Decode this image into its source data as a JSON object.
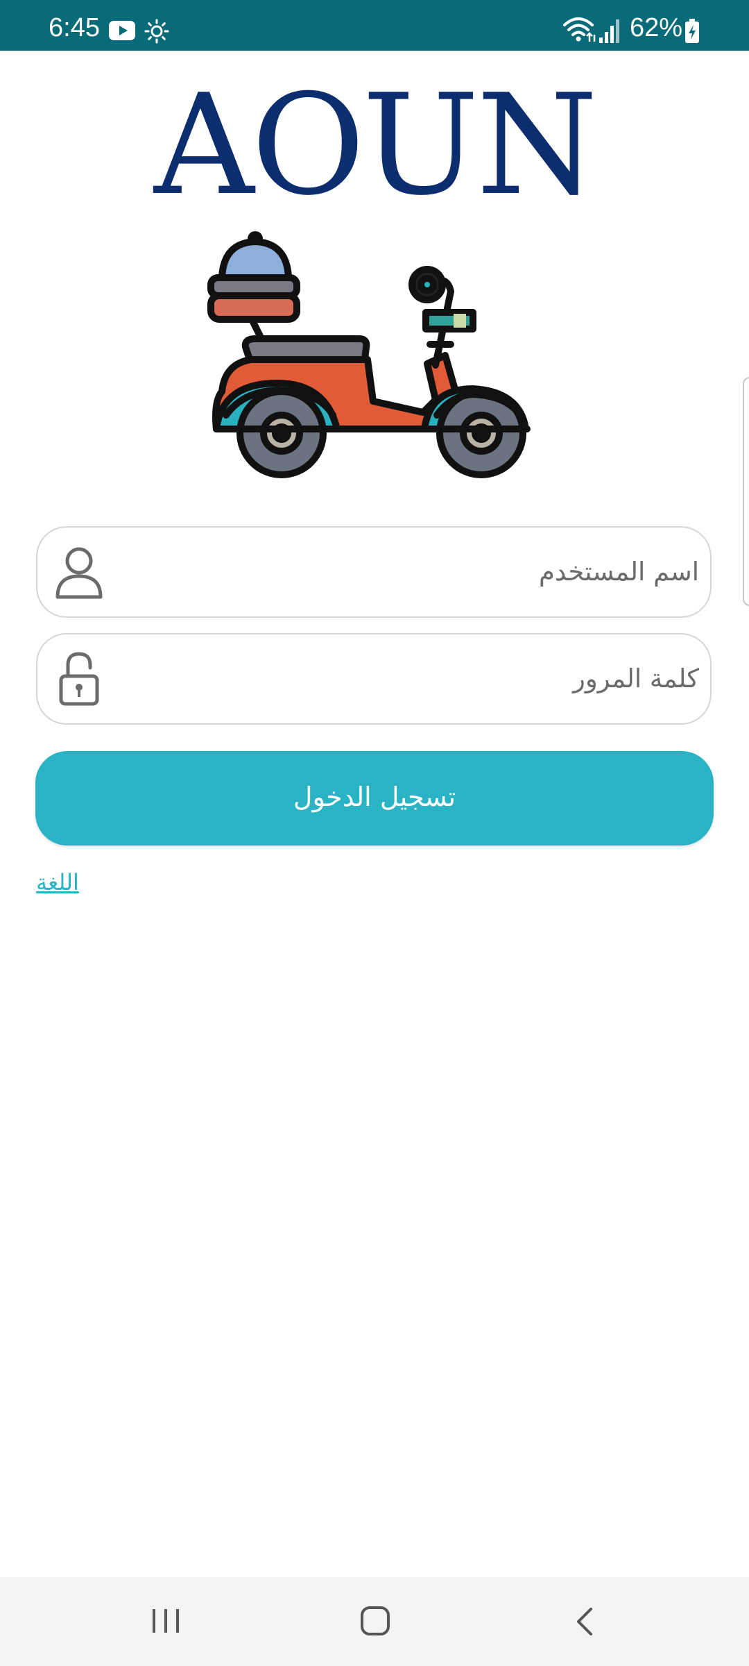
{
  "status_bar": {
    "time": "6:45",
    "battery": "62%",
    "icons": [
      "youtube-icon",
      "sun-icon",
      "wifi-icon",
      "signal-icon",
      "battery-icon"
    ],
    "background_color": "#0a6b78"
  },
  "logo": {
    "text": "AOUN",
    "illustration": "scooter-icon",
    "text_color": "#0c2e6e"
  },
  "form": {
    "username_placeholder": "اسم المستخدم",
    "username_icon": "user-icon",
    "password_placeholder": "كلمة المرور",
    "password_icon": "lock-icon",
    "login_label": "تسجيل الدخول",
    "button_color": "#29b3c4"
  },
  "language_link": "اللغة",
  "nav_bar": {
    "icons": [
      "recents-icon",
      "home-icon",
      "back-icon"
    ]
  }
}
